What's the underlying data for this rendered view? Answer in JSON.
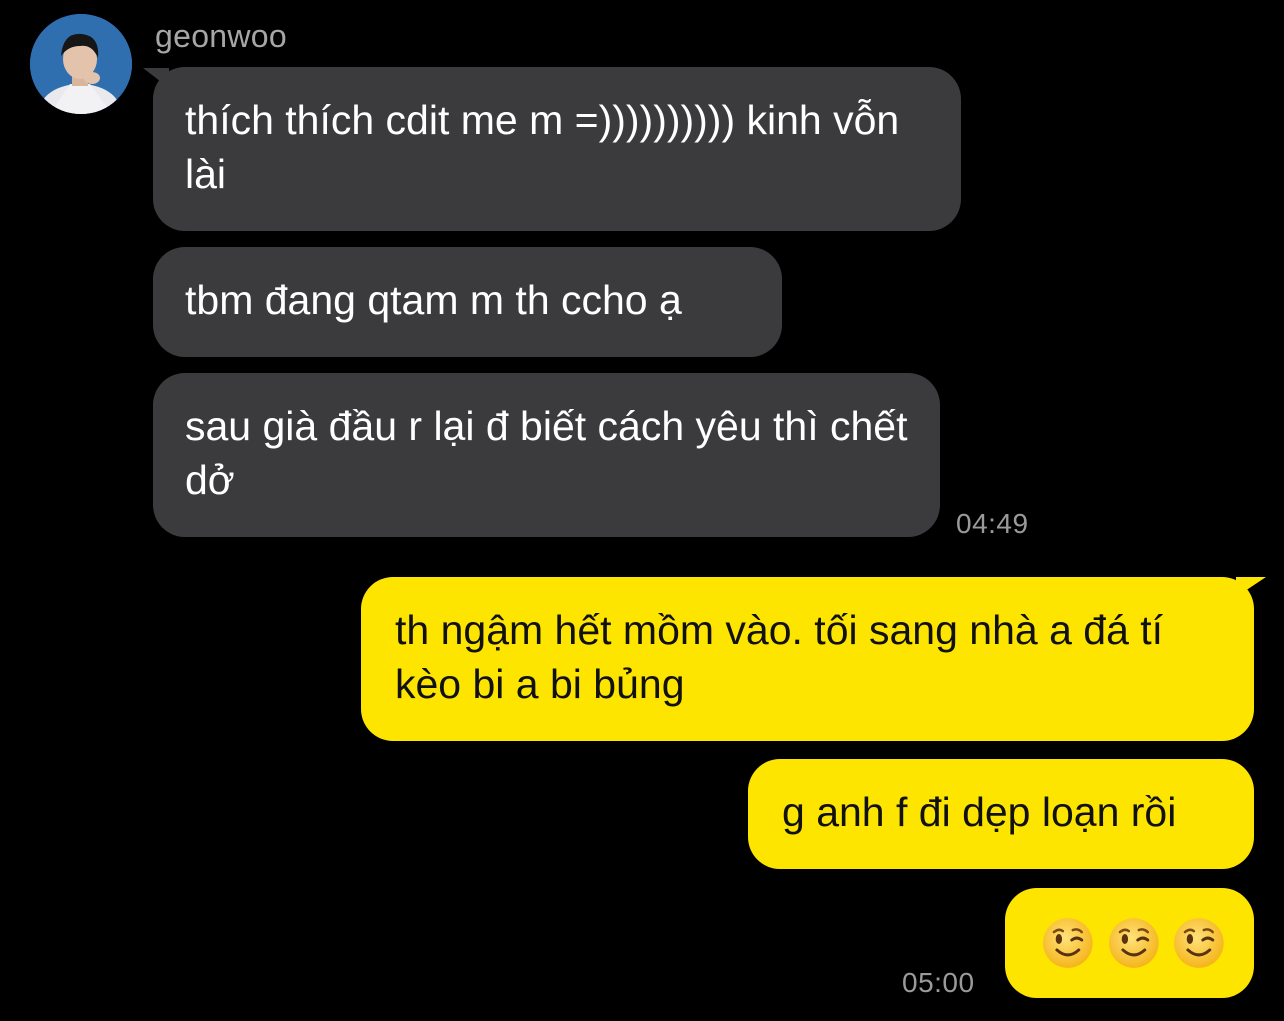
{
  "sender": {
    "name": "geonwoo"
  },
  "messages": [
    {
      "direction": "in",
      "text": "thích thích cdit me m =)))))))))) kinh vỗn lài"
    },
    {
      "direction": "in",
      "text": "tbm đang qtam m th ccho ạ"
    },
    {
      "direction": "in",
      "text": "sau già đầu r lại đ biết cách yêu thì chết dở",
      "time": "04:49"
    },
    {
      "direction": "out",
      "text": "th ngậm hết mồm vào. tối sang nhà a đá tí kèo bi a bi bủng"
    },
    {
      "direction": "out",
      "text": "g anh f đi dẹp loạn rồi"
    },
    {
      "direction": "out",
      "emoji": [
        "winking-face",
        "winking-face",
        "winking-face"
      ],
      "time": "05:00"
    }
  ],
  "colors": {
    "background": "#000000",
    "incoming_bubble": "#3b3b3d",
    "outgoing_bubble": "#fee500",
    "incoming_text": "#ffffff",
    "outgoing_text": "#111111",
    "meta_text": "#9a9a9a"
  }
}
